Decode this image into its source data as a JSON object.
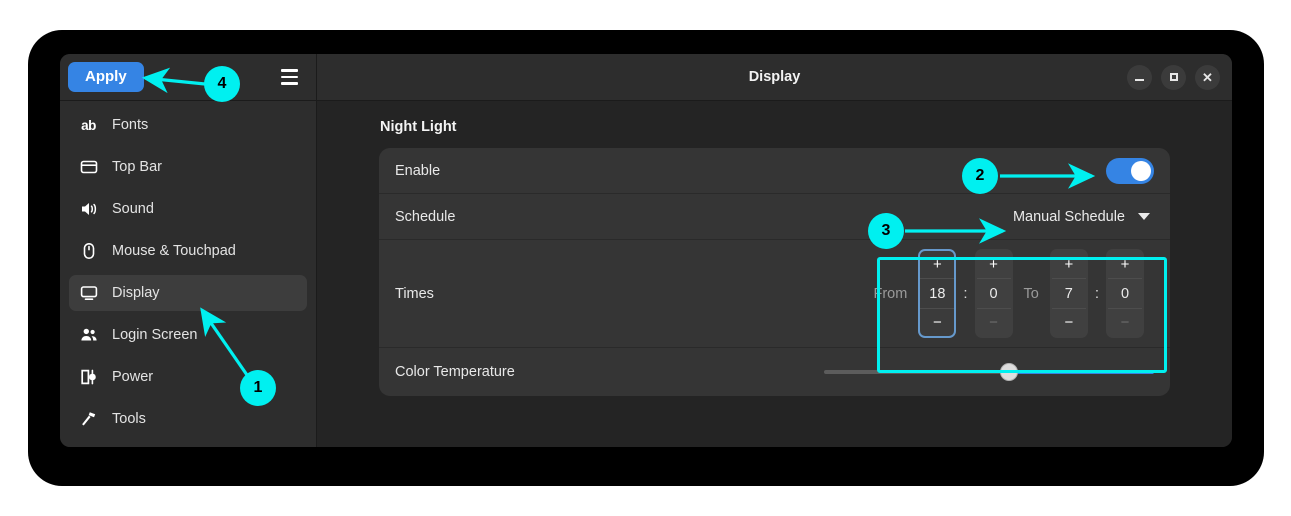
{
  "window": {
    "title": "Display",
    "apply_label": "Apply",
    "menu_icon": "hamburger-menu-icon",
    "controls": {
      "minimize": "minimize-icon",
      "maximize": "maximize-icon",
      "close": "close-icon"
    }
  },
  "sidebar": {
    "items": [
      {
        "label": "Fonts",
        "icon": "ab-text-icon",
        "selected": false
      },
      {
        "label": "Top Bar",
        "icon": "top-bar-icon",
        "selected": false
      },
      {
        "label": "Sound",
        "icon": "speaker-icon",
        "selected": false
      },
      {
        "label": "Mouse & Touchpad",
        "icon": "mouse-icon",
        "selected": false
      },
      {
        "label": "Display",
        "icon": "monitor-icon",
        "selected": true
      },
      {
        "label": "Login Screen",
        "icon": "people-icon",
        "selected": false
      },
      {
        "label": "Power",
        "icon": "power-plug-icon",
        "selected": false
      },
      {
        "label": "Tools",
        "icon": "hammer-icon",
        "selected": false
      }
    ]
  },
  "main": {
    "section_title": "Night Light",
    "rows": {
      "enable": {
        "label": "Enable",
        "toggle_state": "on"
      },
      "schedule": {
        "label": "Schedule",
        "value": "Manual Schedule",
        "caret_icon": "chevron-down-icon"
      },
      "times": {
        "label": "Times",
        "from_label": "From",
        "to_label": "To",
        "separator": ":",
        "plus_label": "+",
        "minus_label": "−",
        "from_hour": "18",
        "from_minute": "0",
        "to_hour": "7",
        "to_minute": "0"
      },
      "temperature": {
        "label": "Color Temperature",
        "value_percent": 56
      }
    }
  },
  "annotations": {
    "accent_color": "#00f0f0",
    "badges": [
      {
        "number": "1",
        "target": "sidebar-item-display"
      },
      {
        "number": "2",
        "target": "enable-toggle"
      },
      {
        "number": "3",
        "target": "schedule-dropdown"
      },
      {
        "number": "4",
        "target": "apply-button"
      }
    ]
  },
  "colors": {
    "accent_blue": "#3584e4",
    "window_bg": "#242424",
    "card_bg": "#353535",
    "sidebar_bg": "#2d2d2d",
    "annotation_cyan": "#00f0f0"
  }
}
